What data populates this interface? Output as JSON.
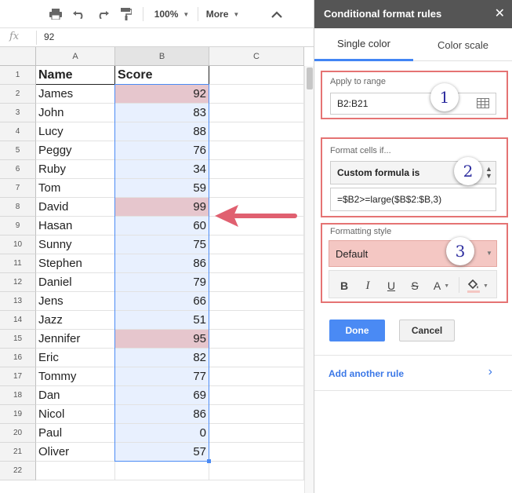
{
  "toolbar": {
    "zoom": "100%",
    "more": "More"
  },
  "formula_bar": {
    "fx": "fx",
    "value": "92"
  },
  "columns": [
    "A",
    "B",
    "C"
  ],
  "rows": [
    {
      "n": "1",
      "a": "Name",
      "b": "Score",
      "head": true,
      "hl": false
    },
    {
      "n": "2",
      "a": "James",
      "b": "92",
      "head": false,
      "hl": true
    },
    {
      "n": "3",
      "a": "John",
      "b": "83",
      "head": false,
      "hl": false
    },
    {
      "n": "4",
      "a": "Lucy",
      "b": "88",
      "head": false,
      "hl": false
    },
    {
      "n": "5",
      "a": "Peggy",
      "b": "76",
      "head": false,
      "hl": false
    },
    {
      "n": "6",
      "a": "Ruby",
      "b": "34",
      "head": false,
      "hl": false
    },
    {
      "n": "7",
      "a": "Tom",
      "b": "59",
      "head": false,
      "hl": false
    },
    {
      "n": "8",
      "a": "David",
      "b": "99",
      "head": false,
      "hl": true
    },
    {
      "n": "9",
      "a": "Hasan",
      "b": "60",
      "head": false,
      "hl": false
    },
    {
      "n": "10",
      "a": "Sunny",
      "b": "75",
      "head": false,
      "hl": false
    },
    {
      "n": "11",
      "a": "Stephen",
      "b": "86",
      "head": false,
      "hl": false
    },
    {
      "n": "12",
      "a": "Daniel",
      "b": "79",
      "head": false,
      "hl": false
    },
    {
      "n": "13",
      "a": "Jens",
      "b": "66",
      "head": false,
      "hl": false
    },
    {
      "n": "14",
      "a": "Jazz",
      "b": "51",
      "head": false,
      "hl": false
    },
    {
      "n": "15",
      "a": "Jennifer",
      "b": "95",
      "head": false,
      "hl": true
    },
    {
      "n": "16",
      "a": "Eric",
      "b": "82",
      "head": false,
      "hl": false
    },
    {
      "n": "17",
      "a": "Tommy",
      "b": "77",
      "head": false,
      "hl": false
    },
    {
      "n": "18",
      "a": "Dan",
      "b": "69",
      "head": false,
      "hl": false
    },
    {
      "n": "19",
      "a": "Nicol",
      "b": "86",
      "head": false,
      "hl": false
    },
    {
      "n": "20",
      "a": "Paul",
      "b": "0",
      "head": false,
      "hl": false
    },
    {
      "n": "21",
      "a": "Oliver",
      "b": "57",
      "head": false,
      "hl": false
    },
    {
      "n": "22",
      "a": "",
      "b": "",
      "head": false,
      "hl": false
    }
  ],
  "panel": {
    "title": "Conditional format rules",
    "close": "✕",
    "tabs": [
      "Single color",
      "Color scale"
    ],
    "apply": {
      "label": "Apply to range",
      "value": "B2:B21"
    },
    "condition": {
      "label": "Format cells if...",
      "rule": "Custom formula is",
      "formula": "=$B2>=large($B$2:$B,3)"
    },
    "style": {
      "label": "Formatting style",
      "value": "Default"
    },
    "badges": [
      "1",
      "2",
      "3"
    ],
    "format_buttons": {
      "bold": "B",
      "italic": "I",
      "underline": "U",
      "strike": "S",
      "text_color": "A"
    },
    "done": "Done",
    "cancel": "Cancel",
    "add_rule": "Add another rule",
    "add_rule_chevron": "›"
  },
  "colors": {
    "highlight": "#e6c6cd",
    "default_style": "#f4c7c3",
    "annotation": "#e57373",
    "done": "#4a8af4"
  }
}
